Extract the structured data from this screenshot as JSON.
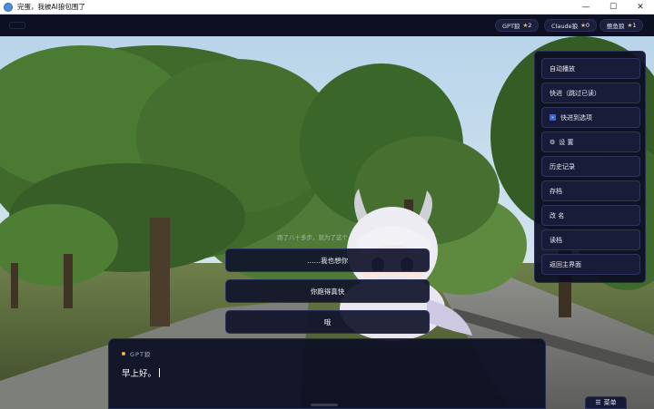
{
  "window": {
    "title": "完蛋，我被AI狼包围了",
    "controls": [
      "—",
      "☐",
      "✕"
    ]
  },
  "votes": [
    {
      "label": "GPT狼",
      "count": "2"
    },
    {
      "label": "Claude狼",
      "count": "0"
    },
    {
      "label": "鲍鱼狼",
      "count": "1"
    }
  ],
  "side_menu": {
    "items": [
      {
        "label": "自动播放",
        "icon": ""
      },
      {
        "label": "快进（跳过已读）",
        "icon": ""
      },
      {
        "label": "快进到选项",
        "icon": "fast-forward-icon",
        "glyph": "»"
      },
      {
        "label": "设 置",
        "icon": "gear-icon",
        "glyph": "⚙"
      },
      {
        "label": "历史记录",
        "icon": ""
      },
      {
        "label": "存档",
        "icon": ""
      },
      {
        "label": "改 名",
        "icon": ""
      },
      {
        "label": "读档",
        "icon": ""
      },
      {
        "label": "返回主界面",
        "icon": ""
      }
    ]
  },
  "choices": {
    "hint": "跑了八十多步，就为了这个",
    "options": [
      "……我也想你",
      "你跑得真快",
      "哦"
    ]
  },
  "dialog": {
    "speaker": "GPT狼",
    "text": "早上好。"
  },
  "menu_button": {
    "label": "菜单",
    "icon": "menu-icon",
    "glyph": "☰"
  },
  "colors": {
    "panel": "#0e1024",
    "accent": "#f0b43a",
    "star": "#f2c14e"
  }
}
